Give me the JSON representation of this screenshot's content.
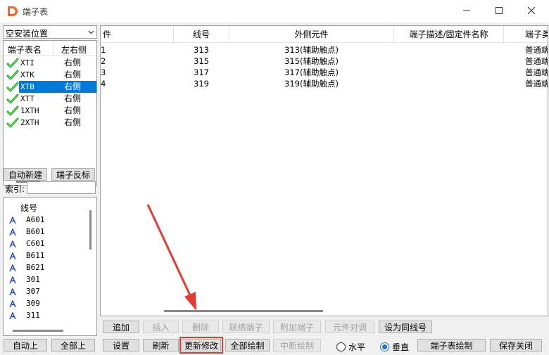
{
  "window": {
    "title": "端子表"
  },
  "left": {
    "combo_value": "空安装位置",
    "terminal_list": {
      "headers": [
        "端子表名",
        "左右侧"
      ],
      "rows": [
        {
          "name": "XTI",
          "side": "右侧"
        },
        {
          "name": "XTK",
          "side": "右侧"
        },
        {
          "name": "XTB",
          "side": "右侧"
        },
        {
          "name": "XTT",
          "side": "右侧"
        },
        {
          "name": "1XTH",
          "side": "右侧"
        },
        {
          "name": "2XTH",
          "side": "右侧"
        }
      ],
      "selected_index": 2
    },
    "buttons": {
      "auto_new": "自动新建",
      "reverse": "端子反标",
      "auto_up": "自动上",
      "all_up": "全部上"
    },
    "index_label": "索引:",
    "wire_list": {
      "header": "线号",
      "items": [
        "A601",
        "B601",
        "C601",
        "B611",
        "B621",
        "301",
        "307",
        "309",
        "311"
      ]
    }
  },
  "grid": {
    "headers": [
      "件",
      "线号",
      "外侧元件",
      "端子描述/固定件名称",
      "端子类"
    ],
    "rows": [
      [
        "1",
        "313",
        "313(辅助触点)",
        "",
        "普通端"
      ],
      [
        "2",
        "315",
        "315(辅助触点)",
        "",
        "普通端"
      ],
      [
        "3",
        "317",
        "317(辅助触点)",
        "",
        "普通端"
      ],
      [
        "4",
        "319",
        "319(辅助触点)",
        "",
        "普通端"
      ]
    ]
  },
  "toolbar": {
    "row1": {
      "add": "追加",
      "insert": "插入",
      "delete": "删除",
      "link": "联络端子",
      "attach": "附加端子",
      "align": "元件对调",
      "same_wire": "设为同线号"
    },
    "row2": {
      "settings": "设置",
      "refresh": "刷新",
      "update": "更新修改",
      "draw_all": "全部绘制",
      "stop_draw": "中断绘制",
      "horizontal": "水平",
      "vertical": "垂直",
      "draw_table": "端子表绘制",
      "save_close": "保存关闭"
    },
    "orientation_selected": "vertical"
  },
  "colors": {
    "selection": "#0078d7",
    "annotation": "#e53935",
    "check": "#2db82d"
  }
}
